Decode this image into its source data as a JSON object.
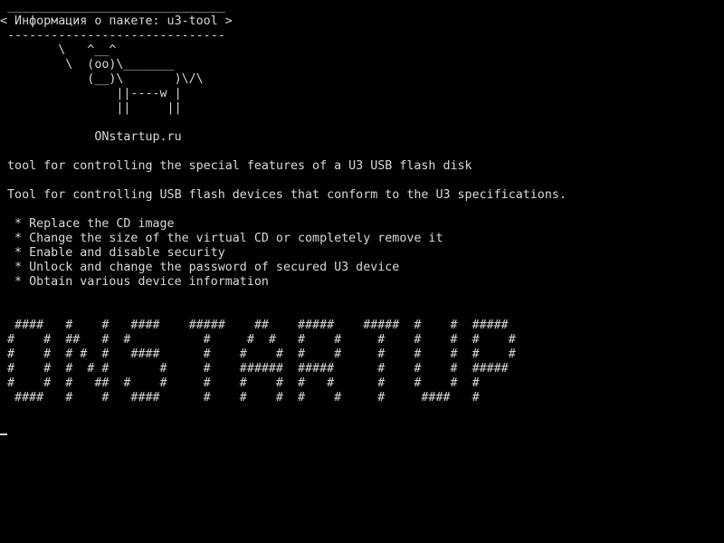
{
  "terminal": {
    "bubble": {
      "top_border": " ______________________________",
      "text": "< Информация о пакете: u3-tool >",
      "bottom_border": " ------------------------------"
    },
    "cow": [
      "        \\   ^__^",
      "         \\  (oo)\\_______",
      "            (__)\\       )\\/\\",
      "                ||----w |",
      "                ||     ||"
    ],
    "site": "             ONstartup.ru",
    "summary": " tool for controlling the special features of a U3 USB flash disk",
    "description": " Tool for controlling USB flash devices that conform to the U3 specifications.",
    "features": [
      "  * Replace the CD image",
      "  * Change the size of the virtual CD or completely remove it",
      "  * Enable and disable security",
      "  * Unlock and change the password of secured U3 device",
      "  * Obtain various device information"
    ],
    "banner": [
      "  ####   #    #   ####    #####    ##    #####    #####  #    #  #####",
      " #    #  ##   #  #          #     #  #   #    #     #    #    #  #    #",
      " #    #  # #  #   ####      #    #    #  #    #     #    #    #  #    #",
      " #    #  #  # #       #     #    ######  #####      #    #    #  #####",
      " #    #  #   ##  #    #     #    #    #  #   #      #    #    #  #",
      "  ####   #    #   ####      #    #    #  #    #     #     ####   #"
    ]
  }
}
